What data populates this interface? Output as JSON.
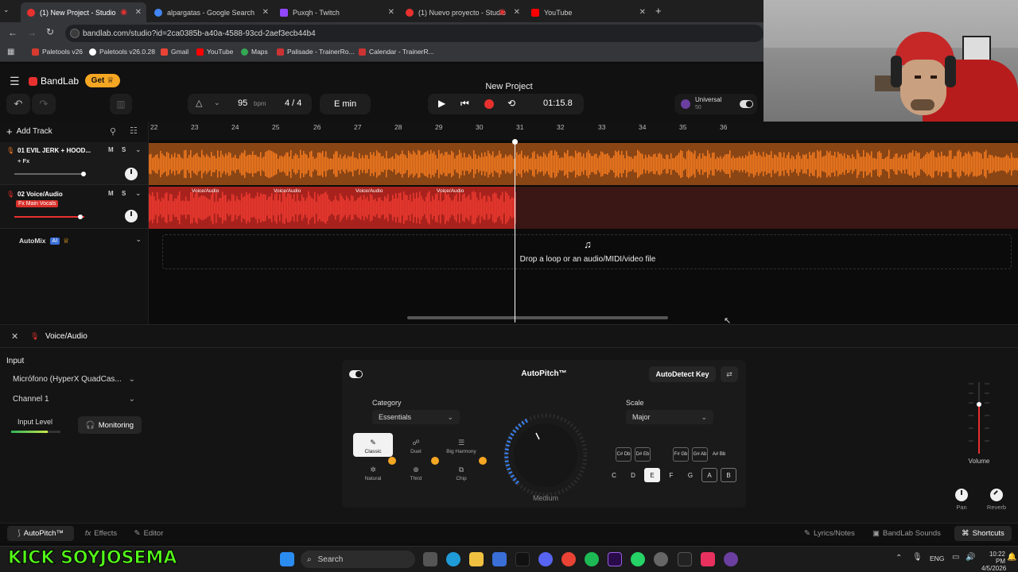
{
  "browser": {
    "tabs": [
      {
        "title": "(1) New Project - Studio",
        "active": true
      },
      {
        "title": "alpargatas - Google Search",
        "active": false
      },
      {
        "title": "Puxqh - Twitch",
        "active": false
      },
      {
        "title": "(1) Nuevo proyecto - Studio",
        "active": false
      },
      {
        "title": "YouTube",
        "active": false
      }
    ],
    "url": "bandlab.com/studio?id=2ca0385b-a40a-4588-93cd-2aef3ecb44b4",
    "bookmarks": [
      "Paletools v26",
      "Paletools v26.0.28",
      "Gmail",
      "YouTube",
      "Maps",
      "Palisade - TrainerRo...",
      "Calendar - TrainerR..."
    ]
  },
  "app": {
    "brand": "BandLab",
    "get_label": "Get",
    "project_title": "New Project",
    "bpm": "95",
    "bpm_unit": "bpm",
    "time_sig": "4 / 4",
    "key": "E min",
    "time": "01:15.8",
    "universal_label": "Universal",
    "universal_sub": "50",
    "add_track": "Add Track"
  },
  "ruler": [
    "22",
    "23",
    "24",
    "25",
    "26",
    "27",
    "28",
    "29",
    "30",
    "31",
    "32",
    "33",
    "34",
    "35",
    "36"
  ],
  "tracks": [
    {
      "name": "01  EVIL JERK + HOOD...",
      "fx": "+ Fx",
      "m": "M",
      "s": "S"
    },
    {
      "name": "02  Voice/Audio",
      "fx": "Fx Main Vocals",
      "m": "M",
      "s": "S"
    }
  ],
  "clip_labels": [
    "Voice/Audio",
    "Voice/Audio",
    "Voice/Audio",
    "Voice/Audio"
  ],
  "automix": {
    "label": "AutoMix",
    "badge": "AI"
  },
  "drop_text": "Drop a loop or an audio/MIDI/video file",
  "panel": {
    "title": "Voice/Audio",
    "input_label": "Input",
    "input_device": "Micrófono (HyperX QuadCas...",
    "channel": "Channel 1",
    "input_level": "Input Level",
    "monitoring": "Monitoring",
    "autopitch_title": "AutoPitch™",
    "autodetect": "AutoDetect Key",
    "category_label": "Category",
    "category_value": "Essentials",
    "scale_label": "Scale",
    "scale_value": "Major",
    "knob_label": "Medium",
    "effects": [
      "Classic",
      "Duet",
      "Big Harmony",
      "Natural",
      "Third",
      "Chip"
    ],
    "sharp_keys": [
      "C# Db",
      "D# Eb",
      "F# Gb",
      "G# Ab",
      "A# Bb"
    ],
    "keys": [
      "C",
      "D",
      "E",
      "F",
      "G",
      "A",
      "B"
    ],
    "volume": "Volume",
    "pan": "Pan",
    "reverb": "Reverb"
  },
  "footer": {
    "tabs": [
      "AutoPitch™",
      "Effects",
      "Editor"
    ],
    "right": [
      "Lyrics/Notes",
      "BandLab Sounds",
      "Shortcuts"
    ]
  },
  "overlay": {
    "stream_text": "KICK SOYJOSEMA"
  },
  "taskbar": {
    "search": "Search",
    "lang": "ENG",
    "time": "10:22 PM",
    "date": "4/5/2026"
  },
  "colors": {
    "accent": "#e8312f",
    "orange": "#f47a1f",
    "red_track": "#d9302a",
    "kick_green": "#53fc18"
  }
}
